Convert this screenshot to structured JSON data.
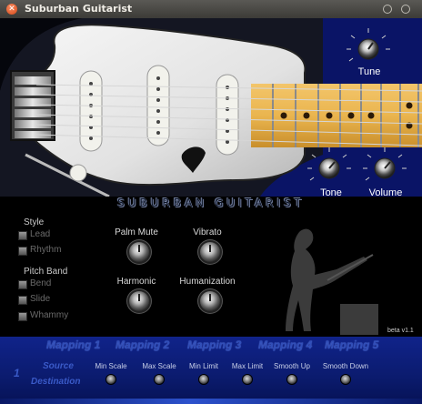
{
  "window": {
    "title": "Suburban Guitarist"
  },
  "header_knobs": {
    "tune": "Tune",
    "tone": "Tone",
    "volume": "Volume"
  },
  "logo": "SUBURBAN GUITARIST",
  "style": {
    "heading": "Style",
    "options": [
      "Lead",
      "Rhythm"
    ]
  },
  "pitch_band": {
    "heading": "Pitch Band",
    "options": [
      "Bend",
      "Slide",
      "Whammy"
    ]
  },
  "effects": {
    "palm_mute": "Palm Mute",
    "vibrato": "Vibrato",
    "harmonic": "Harmonic",
    "humanization": "Humanization"
  },
  "version": "beta v1.1",
  "mapping": {
    "tabs": [
      "Mapping 1",
      "Mapping 2",
      "Mapping 3",
      "Mapping 4",
      "Mapping 5"
    ],
    "row_number": "1",
    "source": "Source",
    "destination": "Destination",
    "sliders": [
      "Min Scale",
      "Max Scale",
      "Min Limit",
      "Max Limit",
      "Smooth Up",
      "Smooth Down"
    ]
  },
  "colors": {
    "accent_blue": "#0b1b6e",
    "title_bar": "#3c3b37"
  }
}
